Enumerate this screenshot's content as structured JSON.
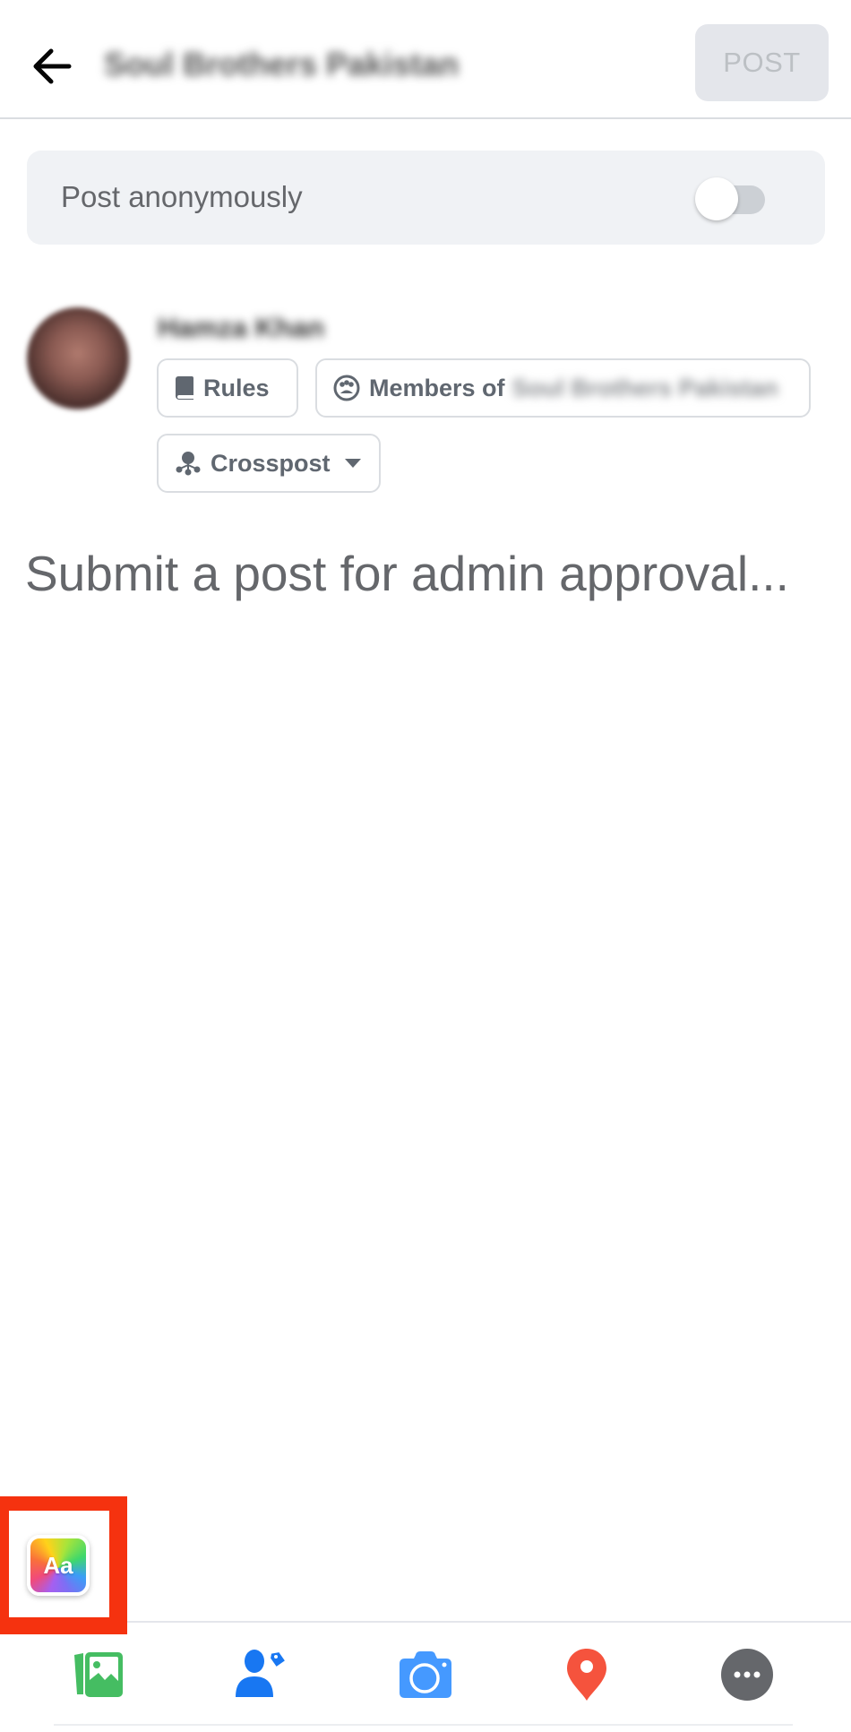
{
  "header": {
    "title": "Soul Brothers Pakistan",
    "post_button": "POST",
    "back_icon": "arrow-left-icon"
  },
  "anonymous": {
    "label": "Post anonymously",
    "toggle_on": false
  },
  "author": {
    "name": "Hamza Khan"
  },
  "chips": {
    "rules": "Rules",
    "members_prefix": "Members of",
    "members_group": "Soul Brothers Pakistan",
    "crosspost": "Crosspost"
  },
  "composer": {
    "placeholder": "Submit a post for admin approval..."
  },
  "text_style_button": {
    "label": "Aa"
  },
  "highlight": {
    "color": "#f5320f"
  },
  "toolbar": [
    {
      "name": "photo-video-icon",
      "color": "#45bd62"
    },
    {
      "name": "tag-people-icon",
      "color": "#1877f2"
    },
    {
      "name": "camera-icon",
      "color": "#4599ff"
    },
    {
      "name": "location-pin-icon",
      "color": "#f5533d"
    },
    {
      "name": "more-options-icon",
      "color": "#65676b"
    }
  ]
}
